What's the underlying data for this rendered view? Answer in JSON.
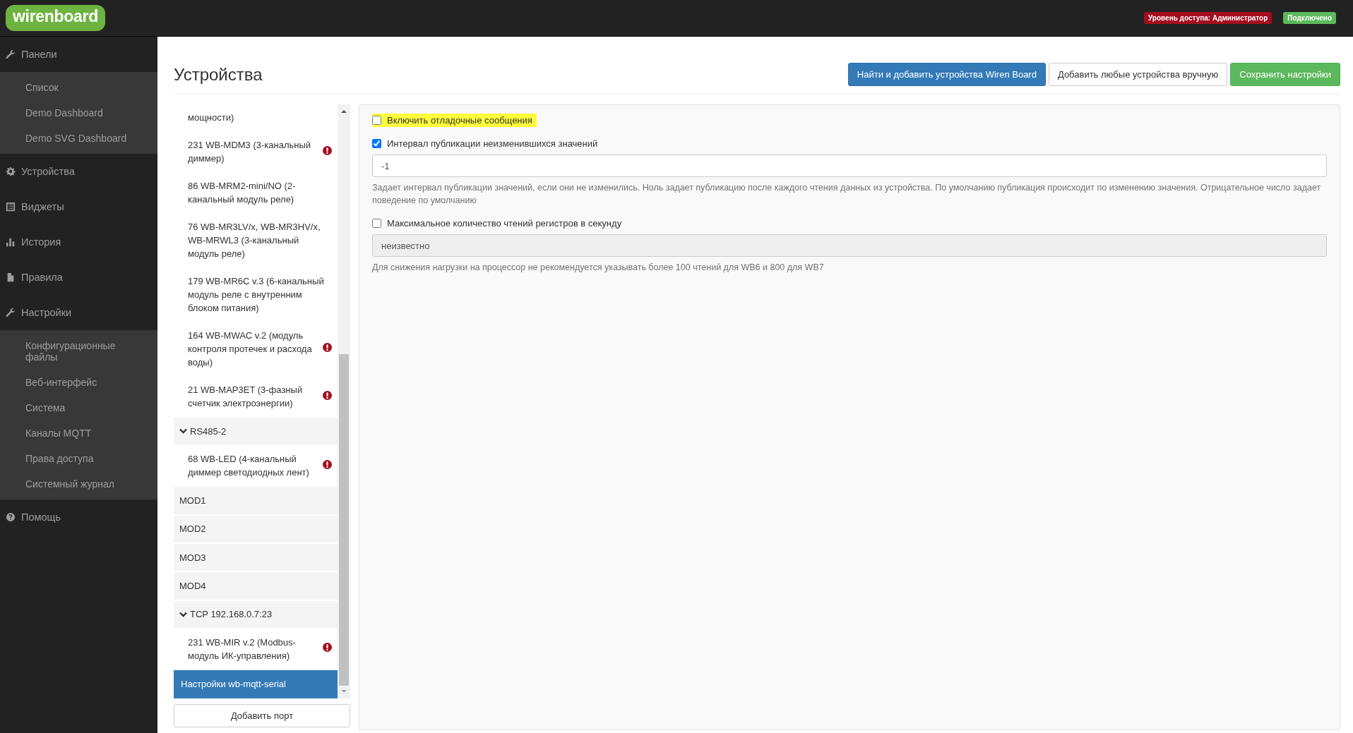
{
  "header": {
    "logo": "wirenboard",
    "access_badge": "Уровень доступа: Администратор",
    "status_badge": "Подключено"
  },
  "sidebar": {
    "items": [
      {
        "label": "Панели",
        "children": [
          {
            "label": "Список"
          },
          {
            "label": "Demo Dashboard"
          },
          {
            "label": "Demo SVG Dashboard"
          }
        ]
      },
      {
        "label": "Устройства"
      },
      {
        "label": "Виджеты"
      },
      {
        "label": "История"
      },
      {
        "label": "Правила"
      },
      {
        "label": "Настройки",
        "children": [
          {
            "label": "Конфигурационные файлы"
          },
          {
            "label": "Веб-интерфейс"
          },
          {
            "label": "Система"
          },
          {
            "label": "Каналы MQTT"
          },
          {
            "label": "Права доступа"
          },
          {
            "label": "Системный журнал"
          }
        ]
      },
      {
        "label": "Помощь"
      }
    ]
  },
  "page": {
    "title": "Устройства",
    "buttons": [
      {
        "label": "Найти и добавить устройства Wiren Board",
        "kind": "primary"
      },
      {
        "label": "Добавить любые устройства вручную",
        "kind": "default"
      },
      {
        "label": "Сохранить настройки",
        "kind": "success"
      }
    ]
  },
  "device_list": {
    "items": [
      {
        "kind": "device",
        "label": "мощности)",
        "error": false
      },
      {
        "kind": "device",
        "label": "231 WB-MDM3 (3-канальный диммер)",
        "error": true
      },
      {
        "kind": "device",
        "label": "86 WB-MRM2-mini/NO (2-канальный модуль реле)",
        "error": false
      },
      {
        "kind": "device",
        "label": "76 WB-MR3LV/x, WB-MR3HV/x, WB-MRWL3 (3-канальный модуль реле)",
        "error": false
      },
      {
        "kind": "device",
        "label": "179 WB-MR6C v.3 (6-канальный модуль реле с внутренним блоком питания)",
        "error": false
      },
      {
        "kind": "device",
        "label": "164 WB-MWAC v.2 (модуль контроля протечек и расхода воды)",
        "error": true
      },
      {
        "kind": "device",
        "label": "21 WB-MAP3ET (3-фазный счетчик электроэнергии)",
        "error": true
      },
      {
        "kind": "port",
        "label": "RS485-2",
        "expanded": true
      },
      {
        "kind": "device",
        "label": "68 WB-LED (4-канальный диммер светодиодных лент)",
        "error": true
      },
      {
        "kind": "port",
        "label": "MOD1",
        "expanded": false
      },
      {
        "kind": "port",
        "label": "MOD2",
        "expanded": false
      },
      {
        "kind": "port",
        "label": "MOD3",
        "expanded": false
      },
      {
        "kind": "port",
        "label": "MOD4",
        "expanded": false
      },
      {
        "kind": "port",
        "label": "TCP 192.168.0.7:23",
        "expanded": true
      },
      {
        "kind": "device",
        "label": "231 WB-MIR v.2 (Modbus-модуль ИК-управления)",
        "error": true
      },
      {
        "kind": "settings",
        "label": "Настройки wb-mqtt-serial",
        "selected": true
      }
    ],
    "add_button": "Добавить порт"
  },
  "settings": {
    "options": [
      {
        "label": "Включить отладочные сообщения",
        "checked": false,
        "highlighted": true
      },
      {
        "label": "Интервал публикации неизменившихся значений",
        "checked": true,
        "highlighted": false,
        "value": "-1",
        "disabled": false,
        "help": "Задает интервал публикации значений, если они не изменились. Ноль задает публикацию после каждого чтения данных из устройства. По умолчанию публикация происходит по изменению значения. Отрицательное число задает поведение по умолчанию"
      },
      {
        "label": "Максимальное количество чтений регистров в секунду",
        "checked": false,
        "highlighted": false,
        "value": "неизвестно",
        "disabled": true,
        "help": "Для снижения нагрузки на процессор не рекомендуется указывать более 100 чтений для WB6 и 800 для WB7"
      }
    ]
  }
}
